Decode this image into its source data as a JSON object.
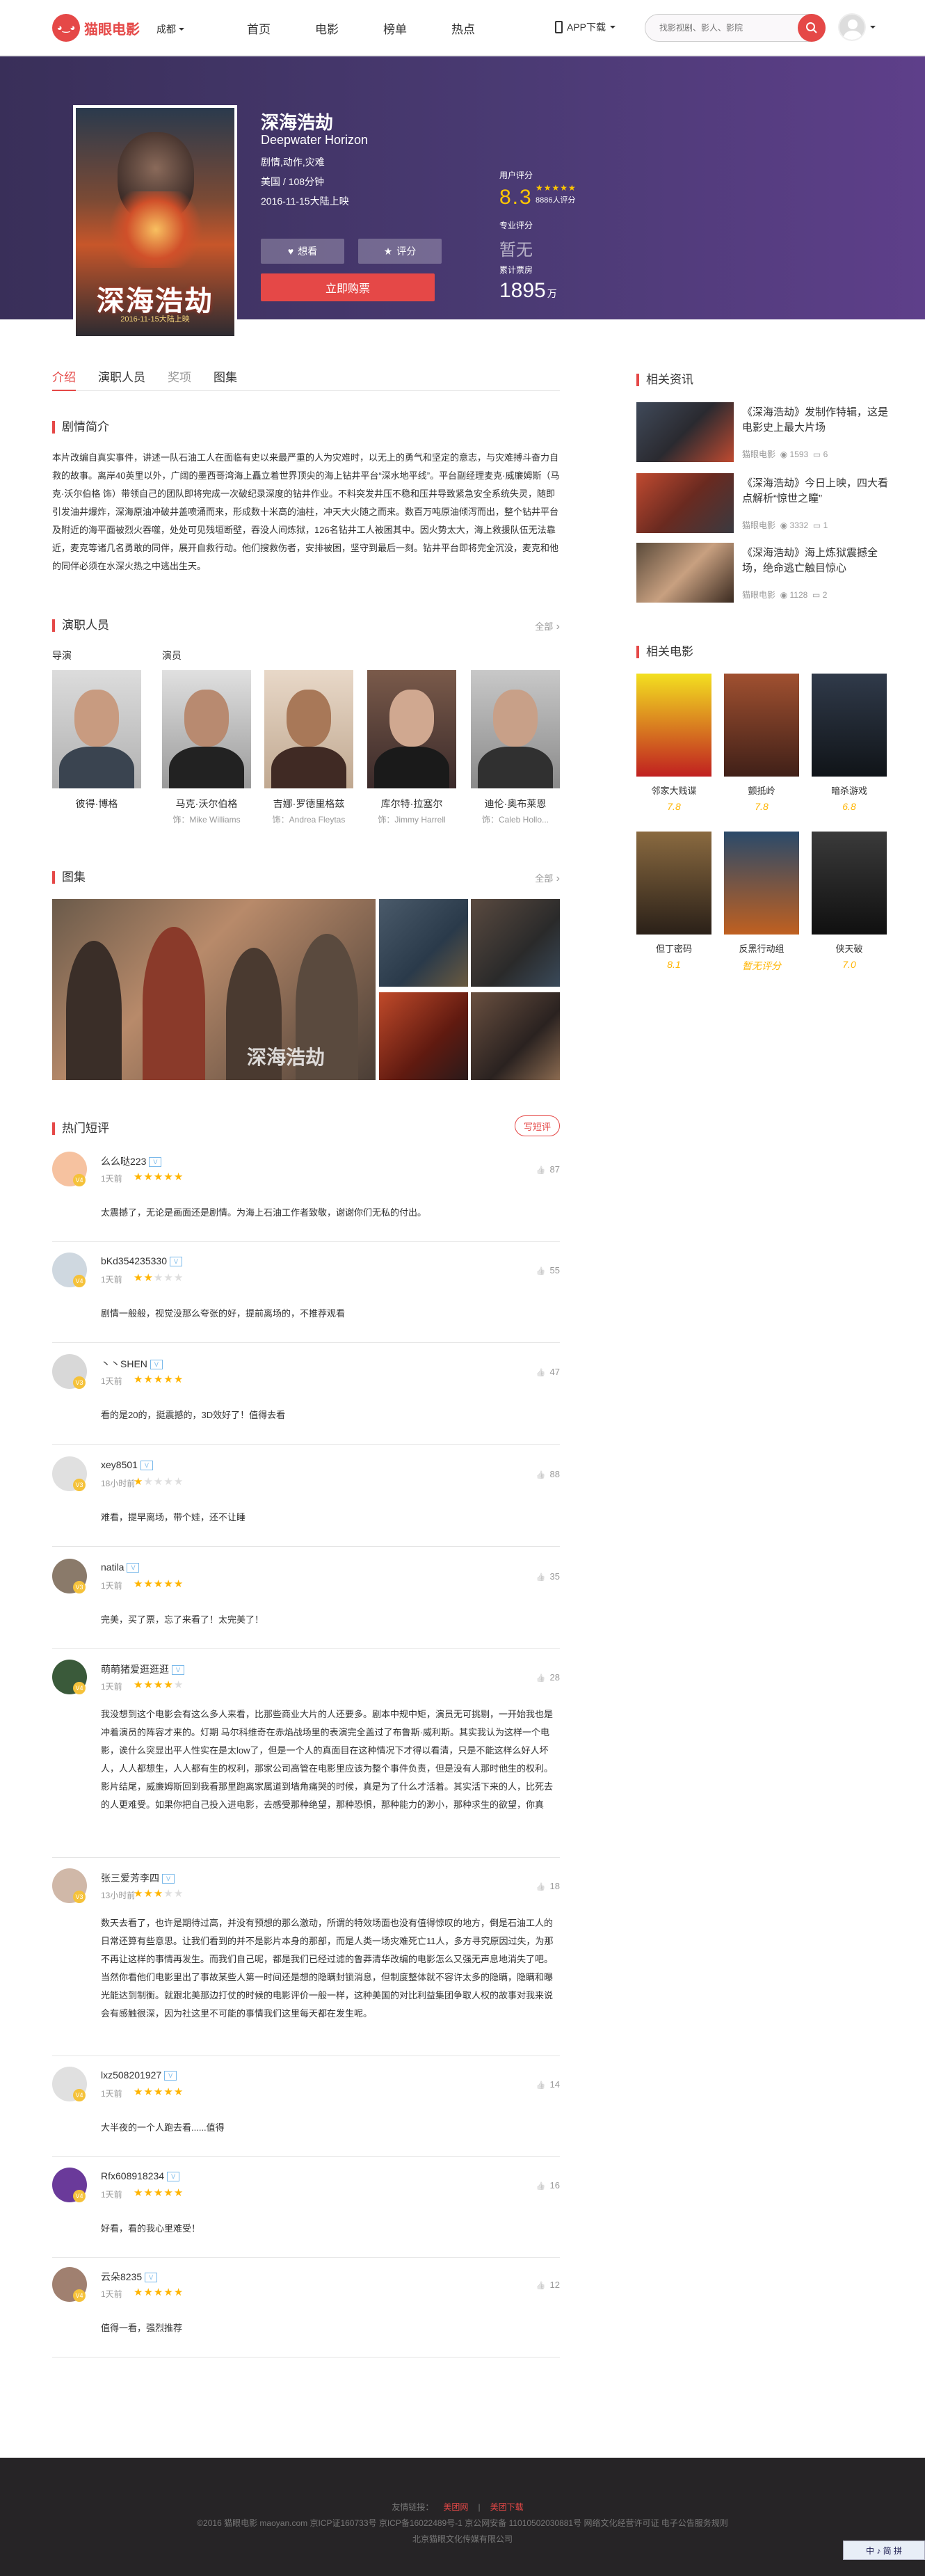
{
  "header": {
    "logo_text": "猫眼电影",
    "city": "成都",
    "nav": [
      "首页",
      "电影",
      "榜单",
      "热点"
    ],
    "app_download": "APP下载",
    "search_placeholder": "找影视剧、影人、影院"
  },
  "movie": {
    "name": "深海浩劫",
    "ename": "Deepwater Horizon",
    "genres": "剧情,动作,灾难",
    "region_duration": "美国 / 108分钟",
    "release": "2016-11-15大陆上映",
    "poster_title": "深海浩劫",
    "btn_want": "想看",
    "btn_rate": "评分",
    "btn_buy": "立即购票",
    "user_score_label": "用户评分",
    "user_score": "8.3",
    "score_count": "8886人评分",
    "pro_score_label": "专业评分",
    "pro_score": "暂无",
    "box_label": "累计票房",
    "box_value": "1895",
    "box_unit": "万"
  },
  "tabs": [
    "介绍",
    "演职人员",
    "奖项",
    "图集"
  ],
  "plot": {
    "title": "剧情简介",
    "text": "本片改编自真实事件，讲述一队石油工人在面临有史以来最严重的人为灾难时，以无上的勇气和坚定的意志，与灾难搏斗奋力自救的故事。离岸40英里以外，广阔的墨西哥湾海上矗立着世界顶尖的海上钻井平台“深水地平线”。平台副经理麦克·威廉姆斯（马克·沃尔伯格 饰）带领自己的团队即将完成一次破纪录深度的钻井作业。不料突发井压不稳和压井导致紧急安全系统失灵，随即引发油井爆炸，深海原油冲破井盖喷涌而来，形成数十米高的油柱，冲天大火随之而来。数百万吨原油倾泻而出，整个钻井平台及附近的海平面被烈火吞噬，处处可见残垣断壁，吞没人间炼狱，126名钻井工人被困其中。因火势太大，海上救援队伍无法靠近，麦克等诸几名勇敢的同伴，展开自救行动。他们搜救伤者，安排被困，坚守到最后一刻。钻井平台即将完全沉没，麦克和他的同伴必须在水深火热之中逃出生天。"
  },
  "cast": {
    "title": "演职人员",
    "more": "全部",
    "director_label": "导演",
    "actor_label": "演员",
    "people": [
      {
        "name": "彼得·博格",
        "role": ""
      },
      {
        "name": "马克·沃尔伯格",
        "role": "饰：Mike Williams"
      },
      {
        "name": "吉娜·罗德里格兹",
        "role": "饰：Andrea Fleytas"
      },
      {
        "name": "库尔特·拉塞尔",
        "role": "饰：Jimmy Harrell"
      },
      {
        "name": "迪伦·奥布莱恩",
        "role": "饰：Caleb Hollo..."
      }
    ]
  },
  "gallery": {
    "title": "图集",
    "more": "全部",
    "watermark": "深海浩劫"
  },
  "comments": {
    "title": "热门短评",
    "write": "写短评",
    "items": [
      {
        "user": "么么哒223",
        "lv": "V4",
        "time": "1天前",
        "stars": 5,
        "likes": "87",
        "text": "太震撼了，无论是画面还是剧情。为海上石油工作者致敬，谢谢你们无私的付出。"
      },
      {
        "user": "bKd354235330",
        "lv": "V4",
        "time": "1天前",
        "stars": 2,
        "likes": "55",
        "text": "剧情一般般，视觉没那么夸张的好，提前离场的，不推荐观看"
      },
      {
        "user": "丶丶SHEN",
        "lv": "V3",
        "time": "1天前",
        "stars": 5,
        "likes": "47",
        "text": "看的是20的，挺震撼的，3D效好了！值得去看"
      },
      {
        "user": "xey8501",
        "lv": "V3",
        "time": "18小时前",
        "stars": 1,
        "likes": "88",
        "text": "难看，提早离场，带个娃，还不让睡"
      },
      {
        "user": "natila",
        "lv": "V3",
        "time": "1天前",
        "stars": 5,
        "likes": "35",
        "text": "完美，买了票，忘了来看了！太完美了！"
      },
      {
        "user": "萌萌猪爱逛逛逛",
        "lv": "V4",
        "time": "1天前",
        "stars": 4,
        "likes": "28",
        "text": "我没想到这个电影会有这么多人来看，比那些商业大片的人还要多。剧本中规中矩，演员无可挑剔，一开始我也是冲着演员的阵容才来的。灯期 马尔科维奇在赤焰战场里的表演完全盖过了布鲁斯·威利斯。其实我认为这样一个电影，诶什么突显出平人性实在是太low了，但是一个人的真面目在这种情况下才得以看清，只是不能这样么好人坏人，人人都想生，人人都有生的权利，那家公司高管在电影里应该为整个事件负责，但是没有人那时他生的权利。影片结尾，威廉姆斯回到我看那里跑离家属道到墙角痛哭的时候，真是为了什么才活着。其实活下来的人，比死去的人更难受。如果你把自己投入进电影，去感受那种绝望，那种恐惧，那种能力的渺小，那种求生的欲望，你真"
      },
      {
        "user": "张三爱芳李四",
        "lv": "V3",
        "time": "13小时前",
        "stars": 3,
        "likes": "18",
        "text": "数天去看了，也许是期待过高，并没有预想的那么激动，所谓的特效场面也没有值得惊叹的地方，倒是石油工人的日常还算有些意思。让我们看到的并不是影片本身的那部，而是人类一场灾难死亡11人，多方寻究原因过失，为那不再让这样的事情再发生。而我们自己呢，都是我们已经过滤的鲁莽清华改编的电影怎么又强无声息地消失了吧。当然你看他们电影里出了事故某些人第一时间还是想的隐瞒封锁消息，但制度整体就不容许太多的隐瞒，隐瞒和曝光能达到制衡。就跟北美那边打仗的时候的电影评价一般一样，这种美国的对比利益集团争取人权的故事对我来说会有感触很深，因为社这里不可能的事情我们这里每天都在发生呢。"
      },
      {
        "user": "lxz508201927",
        "lv": "V4",
        "time": "1天前",
        "stars": 5,
        "likes": "14",
        "text": "大半夜的一个人跑去看......值得"
      },
      {
        "user": "Rfx608918234",
        "lv": "V4",
        "time": "1天前",
        "stars": 5,
        "likes": "16",
        "text": "好看，看的我心里难受！"
      },
      {
        "user": "云朵8235",
        "lv": "V4",
        "time": "1天前",
        "stars": 5,
        "likes": "12",
        "text": "值得一看，强烈推荐"
      }
    ]
  },
  "news": {
    "title": "相关资讯",
    "items": [
      {
        "title": "《深海浩劫》发制作特辑，这是电影史上最大片场",
        "source": "猫眼电影",
        "views": "1593",
        "comments": "6"
      },
      {
        "title": "《深海浩劫》今日上映，四大看点解析“惊世之瞳”",
        "source": "猫眼电影",
        "views": "3332",
        "comments": "1"
      },
      {
        "title": "《深海浩劫》海上炼狱震撼全场，绝命逃亡触目惊心",
        "source": "猫眼电影",
        "views": "1128",
        "comments": "2"
      }
    ]
  },
  "related": {
    "title": "相关电影",
    "items": [
      {
        "name": "邻家大贱谍",
        "score": "7.8",
        "color1": "#f3e020",
        "color2": "#c02020"
      },
      {
        "name": "颤抵岭",
        "score": "7.8",
        "color1": "#a05030",
        "color2": "#402018"
      },
      {
        "name": "暗杀游戏",
        "score": "6.8",
        "color1": "#303a4a",
        "color2": "#101418"
      },
      {
        "name": "但丁密码",
        "score": "8.1",
        "color1": "#8a6a40",
        "color2": "#2a2018"
      },
      {
        "name": "反黑行动组",
        "score": "暂无评分",
        "color1": "#2a4a6a",
        "color2": "#c06020"
      },
      {
        "name": "侠天破",
        "score": "7.0",
        "color1": "#3a3a3a",
        "color2": "#101010"
      }
    ]
  },
  "footer": {
    "links_label": "友情链接：",
    "link1": "美团网",
    "link2": "美团下载",
    "copyright": "©2016 猫眼电影 maoyan.com 京ICP证160733号 京ICP备16022489号-1 京公网安备 11010502030881号 网络文化经营许可证 电子公告服务规则",
    "company": "北京猫眼文化传媒有限公司"
  },
  "ime": "中 ♪ 简 拼"
}
